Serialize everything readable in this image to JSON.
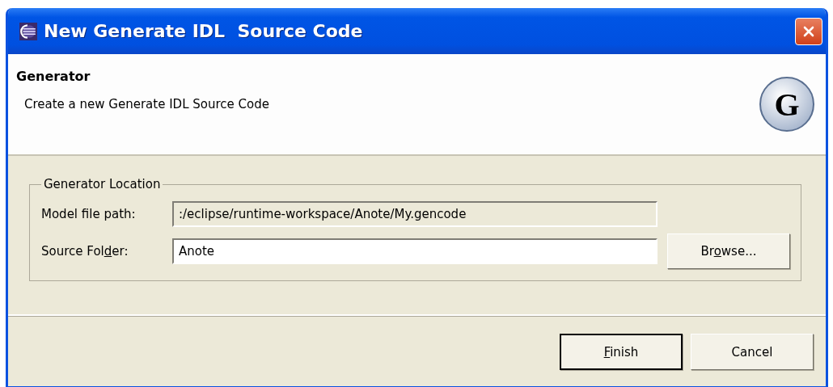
{
  "window": {
    "title": "New Generate IDL  Source Code"
  },
  "header": {
    "title": "Generator",
    "description": "Create a new Generate IDL Source Code",
    "logo_letter": "G"
  },
  "group": {
    "label": "Generator Location",
    "fields": [
      {
        "label": {
          "before": "Model file path:"
        },
        "value": ":/eclipse/runtime-workspace/Anote/My.gencode",
        "disabled": true
      },
      {
        "label": {
          "before": "Source Fol",
          "key": "d",
          "after": "er:"
        },
        "value": "Anote",
        "disabled": false,
        "button": {
          "label": {
            "before": "Br",
            "key": "o",
            "after": "wse..."
          }
        }
      }
    ]
  },
  "buttons": [
    {
      "label": {
        "key": "F",
        "after": "inish"
      },
      "default": true
    },
    {
      "label": {
        "before": "Cancel"
      },
      "default": false
    }
  ]
}
